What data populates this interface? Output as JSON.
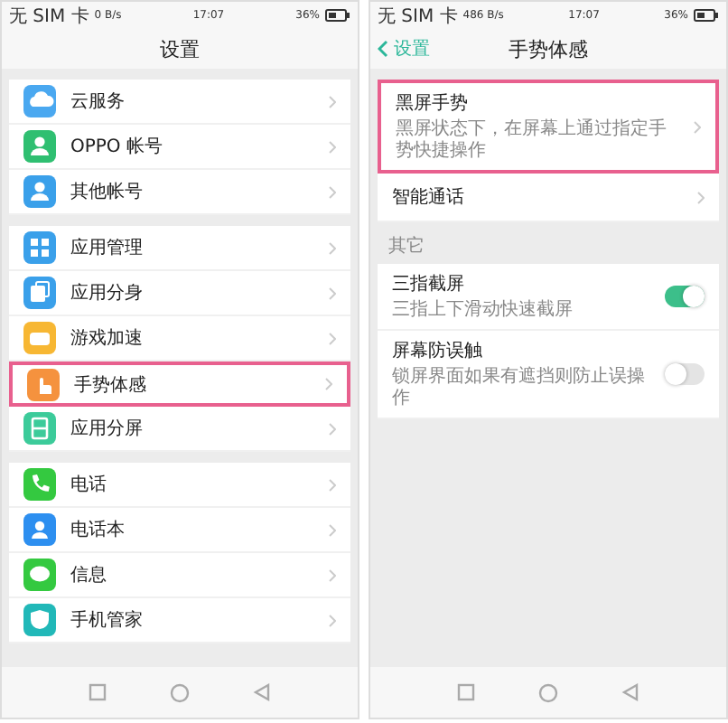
{
  "left_screen": {
    "status_bar": {
      "carrier": "无 SIM 卡",
      "speed": "0 B/s",
      "time": "17:07",
      "battery": "36%"
    },
    "title": "设置",
    "groups": [
      [
        {
          "label": "云服务",
          "color": "#4aa8f0",
          "selected": false
        },
        {
          "label": "OPPO 帐号",
          "color": "#2fbf71",
          "selected": false
        },
        {
          "label": "其他帐号",
          "color": "#3aa0ea",
          "selected": false
        }
      ],
      [
        {
          "label": "应用管理",
          "color": "#3aa0ea",
          "selected": false
        },
        {
          "label": "应用分身",
          "color": "#3aa0ea",
          "selected": false
        },
        {
          "label": "游戏加速",
          "color": "#f7b733",
          "selected": false
        },
        {
          "label": "手势体感",
          "color": "#f5923e",
          "selected": true
        },
        {
          "label": "应用分屏",
          "color": "#3ccb9a",
          "selected": false
        }
      ],
      [
        {
          "label": "电话",
          "color": "#34c940",
          "selected": false
        },
        {
          "label": "电话本",
          "color": "#2d8ff0",
          "selected": false
        },
        {
          "label": "信息",
          "color": "#34c940",
          "selected": false
        },
        {
          "label": "手机管家",
          "color": "#21b8b8",
          "selected": false
        }
      ]
    ]
  },
  "right_screen": {
    "status_bar": {
      "carrier": "无 SIM 卡",
      "speed": "486 B/s",
      "time": "17:07",
      "battery": "36%"
    },
    "back_label": "设置",
    "title": "手势体感",
    "groups": [
      {
        "rows": [
          {
            "kind": "link",
            "title": "黑屏手势",
            "subtitle": "黑屏状态下，在屏幕上通过指定手势快捷操作",
            "selected": true
          },
          {
            "kind": "link",
            "title": "智能通话",
            "selected": false
          }
        ]
      },
      {
        "header": "其它",
        "rows": [
          {
            "kind": "toggle",
            "title": "三指截屏",
            "subtitle": "三指上下滑动快速截屏",
            "on": true,
            "selected": false
          },
          {
            "kind": "toggle",
            "title": "屏幕防误触",
            "subtitle": "锁屏界面如果有遮挡则防止误操作",
            "on": false,
            "selected": false
          }
        ]
      }
    ]
  }
}
